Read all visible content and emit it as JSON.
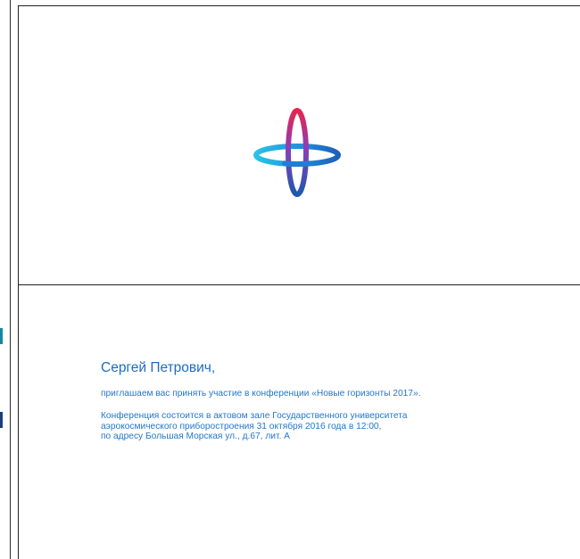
{
  "invitation": {
    "greeting": "Сергей Петрович,",
    "invite_line": "приглашаем вас принять участие в конференции «Новые горизонты 2017».",
    "details_lines": [
      "Конференция состоится в актовом зале Государственного университета",
      "аэрокосмического приборостроения 31 октября 2016 года в 12:00,",
      "по адресу Большая Морская ул., д.67, лит. А"
    ]
  },
  "logo": {
    "icon": "intersecting-rings-logo-icon",
    "colors": {
      "ring_horizontal_start": "#29c3ea",
      "ring_horizontal_end": "#1e5fb8",
      "ring_vertical_top": "#e8234f",
      "ring_vertical_mid": "#8b3fb8",
      "ring_vertical_bottom": "#1e58b0"
    }
  },
  "colors": {
    "text_blue": "#2277cc",
    "greeting_blue": "#1b6cc4",
    "border": "#222222"
  }
}
